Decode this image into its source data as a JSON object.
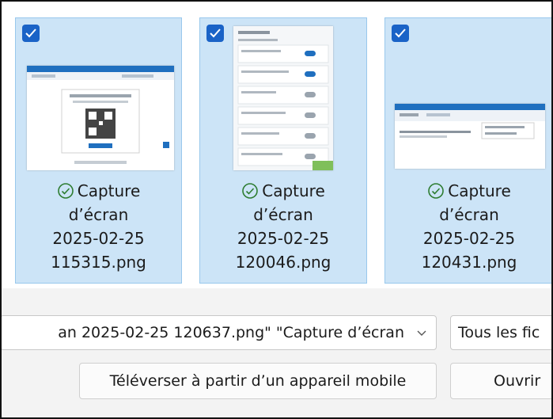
{
  "files": [
    {
      "name_line1": "Capture",
      "name_line2": "d’écran",
      "name_line3": "2025-02-25",
      "name_line4": "115315.png",
      "selected": true,
      "status_icon": "check-circle-icon"
    },
    {
      "name_line1": "Capture",
      "name_line2": "d’écran",
      "name_line3": "2025-02-25",
      "name_line4": "120046.png",
      "selected": true,
      "status_icon": "check-circle-icon"
    },
    {
      "name_line1": "Capture",
      "name_line2": "d’écran",
      "name_line3": "2025-02-25",
      "name_line4": "120431.png",
      "selected": true,
      "status_icon": "check-circle-icon"
    }
  ],
  "filename_input": {
    "value": "an 2025-02-25 120637.png\" \"Capture d’écran"
  },
  "file_type_filter": {
    "value": "Tous les fic"
  },
  "buttons": {
    "upload_mobile": "Téléverser à partir d’un appareil mobile",
    "open": "Ouvrir"
  },
  "colors": {
    "selection": "#cce4f7",
    "selection_border": "#99c8ec",
    "checkbox": "#1a63c7",
    "status_green": "#2e7d32"
  }
}
